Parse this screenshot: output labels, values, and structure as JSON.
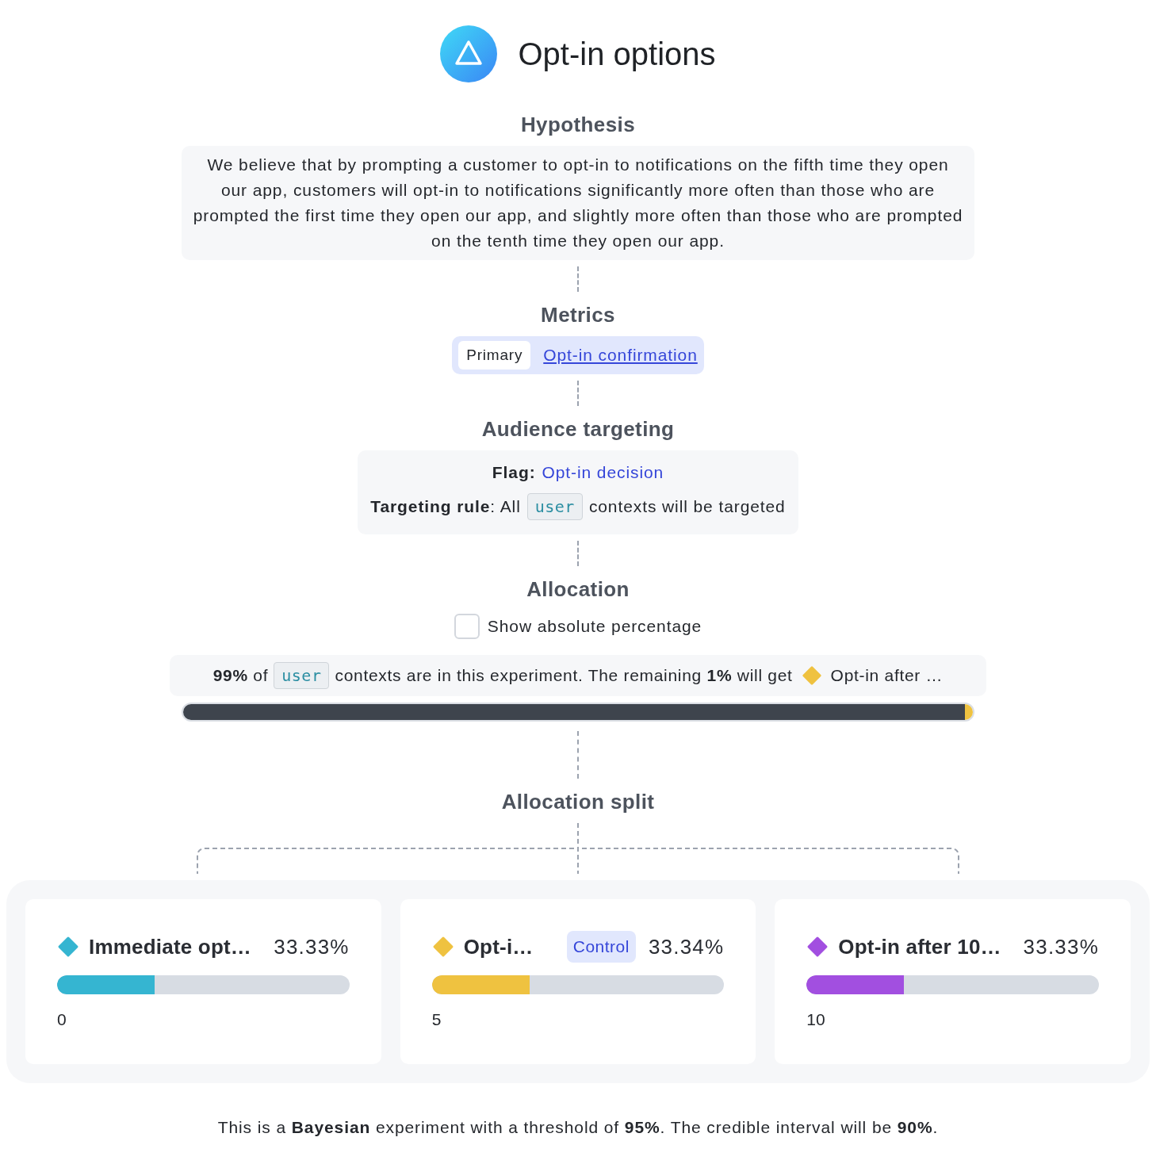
{
  "header": {
    "title": "Opt-in options"
  },
  "hypothesis": {
    "heading": "Hypothesis",
    "text": "We believe that by prompting a customer to opt-in to notifications on the fifth time they open our app, customers will opt-in to notifications significantly more often than those who are prompted the first time they open our app, and slightly more often than those who are prompted on the tenth time they open our app."
  },
  "metrics": {
    "heading": "Metrics",
    "items": [
      {
        "tag": "Primary",
        "name": "Opt-in confirmation"
      }
    ]
  },
  "audience": {
    "heading": "Audience targeting",
    "flag_label": "Flag:",
    "flag": "Opt-in decision",
    "rule_lead": "**Targeting rule**: All",
    "context": "user",
    "rule_tail": "contexts will be targeted"
  },
  "allocation": {
    "heading": "Allocation",
    "checkbox": {
      "label": "Show absolute percentage",
      "checked": false
    },
    "summary_lead": "**99%** of",
    "context": "user",
    "summary_mid": "contexts are in this experiment. The remaining **1%** will get",
    "rollout": {
      "name": "Opt-in after …",
      "color": "#efc240"
    },
    "bar": {
      "level": 0.99
    }
  },
  "split": {
    "heading": "Allocation split",
    "variants": [
      {
        "name": "Immediate opt…",
        "color": "#35b5d1",
        "share": "33.33%",
        "level": 0.3333,
        "value": "0"
      },
      {
        "name": "Opt-i…",
        "color": "#efc240",
        "badge": "Control",
        "share": "33.34%",
        "level": 0.3334,
        "value": "5"
      },
      {
        "name": "Opt-in after 10…",
        "color": "#a24fe0",
        "share": "33.33%",
        "level": 0.3333,
        "value": "10"
      }
    ]
  },
  "footer": {
    "text": "This is a **Bayesian** experiment with a threshold of **95%**. The credible interval will be **90%**."
  }
}
